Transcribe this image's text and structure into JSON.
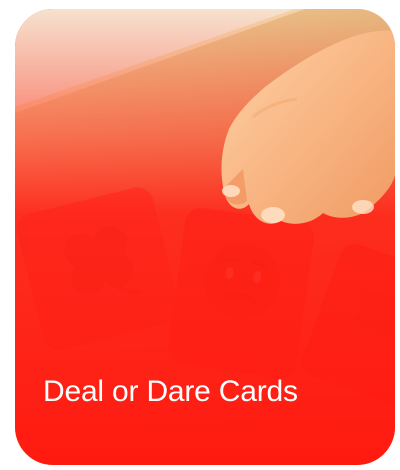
{
  "card": {
    "title": "Deal or Dare Cards",
    "colors": {
      "background_top": "#f6e2cf",
      "table_wood": "#e8b87c",
      "accent_red": "#ff1f14",
      "title_text": "#ffffff"
    },
    "illustration": {
      "icons": [
        "clover-icon",
        "worried-face-icon",
        "hand-icon"
      ]
    }
  }
}
